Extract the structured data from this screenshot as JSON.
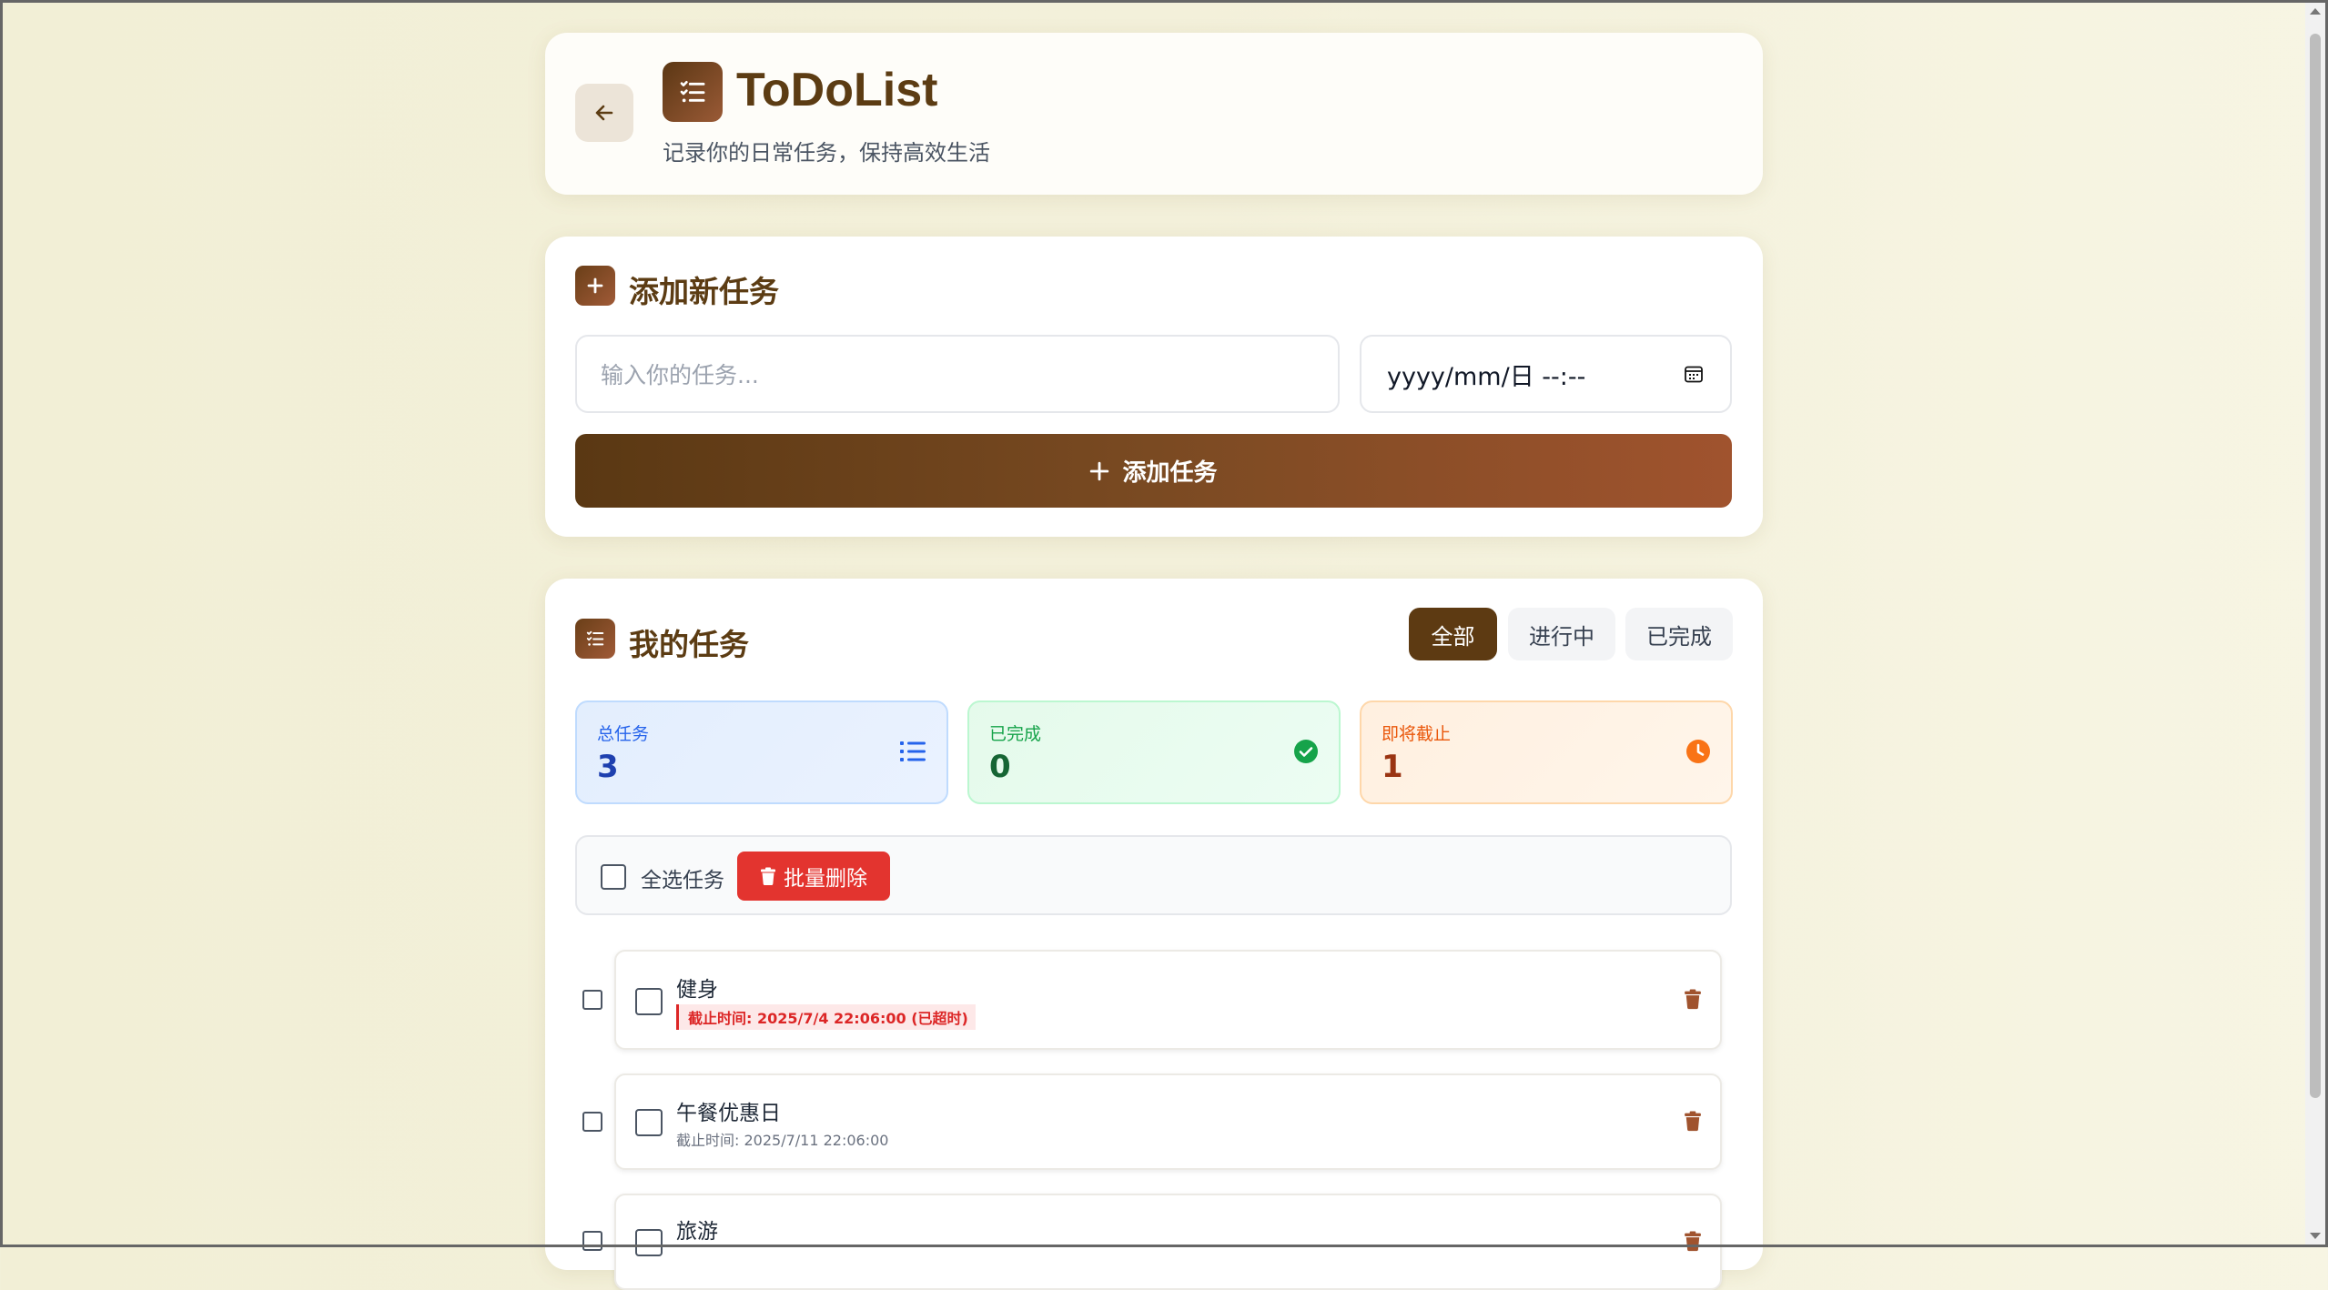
{
  "header": {
    "title": "ToDoList",
    "subtitle": "记录你的日常任务，保持高效生活"
  },
  "add_section": {
    "title": "添加新任务",
    "task_placeholder": "输入你的任务...",
    "date_placeholder": "yyyy/mm/日 --:--",
    "add_button_label": "添加任务"
  },
  "list_section": {
    "title": "我的任务",
    "filters": [
      "全部",
      "进行中",
      "已完成"
    ],
    "active_filter": "全部"
  },
  "stats": {
    "total": {
      "label": "总任务",
      "value": "3"
    },
    "completed": {
      "label": "已完成",
      "value": "0"
    },
    "due_soon": {
      "label": "即将截止",
      "value": "1"
    }
  },
  "bulk": {
    "select_all_label": "全选任务",
    "delete_label": "批量删除"
  },
  "tasks": [
    {
      "name": "健身",
      "deadline": "截止时间: 2025/7/4 22:06:00 (已超时)",
      "overdue": true
    },
    {
      "name": "午餐优惠日",
      "deadline": "截止时间: 2025/7/11 22:06:00",
      "overdue": false
    },
    {
      "name": "旅游",
      "deadline": "",
      "overdue": false
    }
  ],
  "colors": {
    "brand_brown": "#5c3c13",
    "accent_rust": "#a0532e",
    "danger": "#e3342f"
  }
}
